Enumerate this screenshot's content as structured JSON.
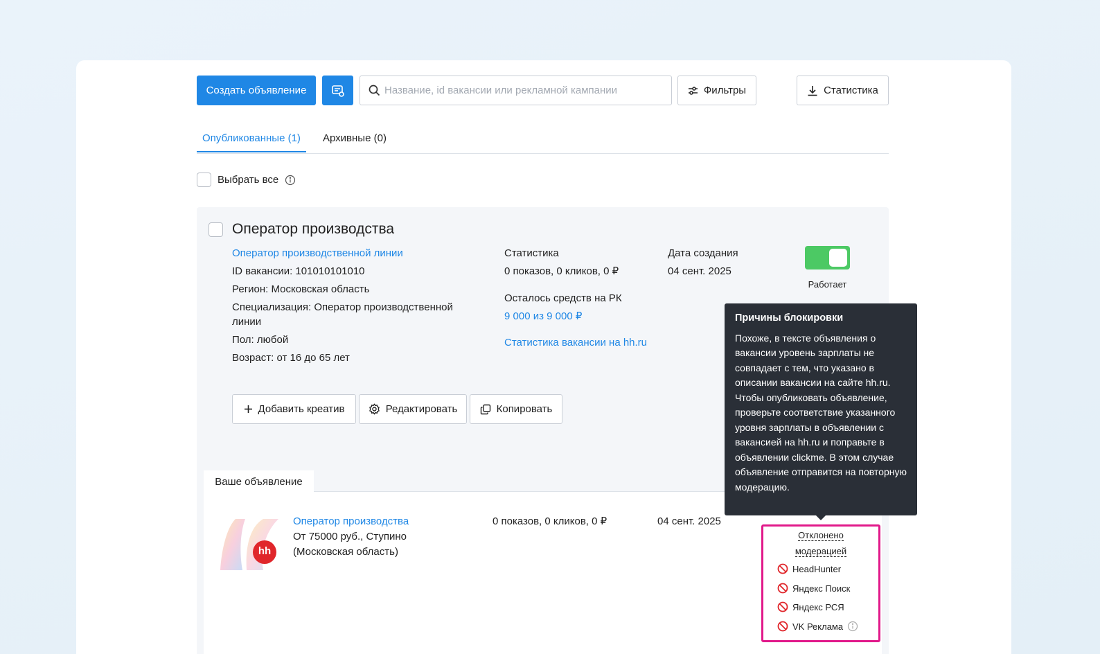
{
  "toolbar": {
    "create_label": "Создать объявление",
    "search_placeholder": "Название, id вакансии или рекламной кампании",
    "filters_label": "Фильтры",
    "stats_label": "Статистика"
  },
  "tabs": [
    {
      "label": "Опубликованные (1)",
      "active": true
    },
    {
      "label": "Архивные (0)",
      "active": false
    }
  ],
  "select_all_label": "Выбрать все",
  "vacancy": {
    "title": "Оператор производства",
    "subtitle_link": "Оператор производственной линии",
    "id_line": "ID вакансии: 101010101010",
    "region_line": "Регион: Московская область",
    "specialization_line": "Специализация: Оператор производственной линии",
    "gender_line": "Пол: любой",
    "age_line": "Возраст: от 16 до 65 лет",
    "stats_heading": "Статистика",
    "stats_value": "0 показов, 0 кликов, 0 ₽",
    "funds_heading": "Осталось средств на РК",
    "funds_value": "9 000 из 9 000 ₽",
    "hh_stats_link": "Статистика вакансии на hh.ru",
    "date_heading": "Дата создания",
    "date_value": "04 сент. 2025",
    "status_label": "Работает",
    "toggle_on": true,
    "actions": {
      "add_creative": "Добавить креатив",
      "edit": "Редактировать",
      "copy": "Копировать"
    }
  },
  "ad": {
    "tab_label": "Ваше объявление",
    "logo_badge": "hh",
    "title_link": "Оператор производства",
    "line1": "От 75000 руб., Ступино",
    "line2": "(Московская область)",
    "stats": "0 показов, 0 кликов, 0 ₽",
    "date": "04 сент. 2025",
    "moderation_line1": "Отклонено",
    "moderation_line2": "модерацией",
    "platforms": [
      "HeadHunter",
      "Яндекс Поиск",
      "Яндекс РСЯ",
      "VK Реклама"
    ]
  },
  "tooltip": {
    "title": "Причины блокировки",
    "body": "Похоже, в тексте объявления о вакансии уровень зарплаты не совпадает с тем, что указано в описании вакансии на сайте hh.ru. Чтобы опубликовать объявление, проверьте соответствие указанного уровня зарплаты в объявлении с вакансией на hh.ru и поправьте в объявлении clickme. В этом случае объявление отправится на повторную модерацию."
  },
  "colors": {
    "accent": "#1f87e5",
    "toggle_on": "#4cc964",
    "highlight": "#e1198a",
    "blocked": "#e0262b"
  }
}
